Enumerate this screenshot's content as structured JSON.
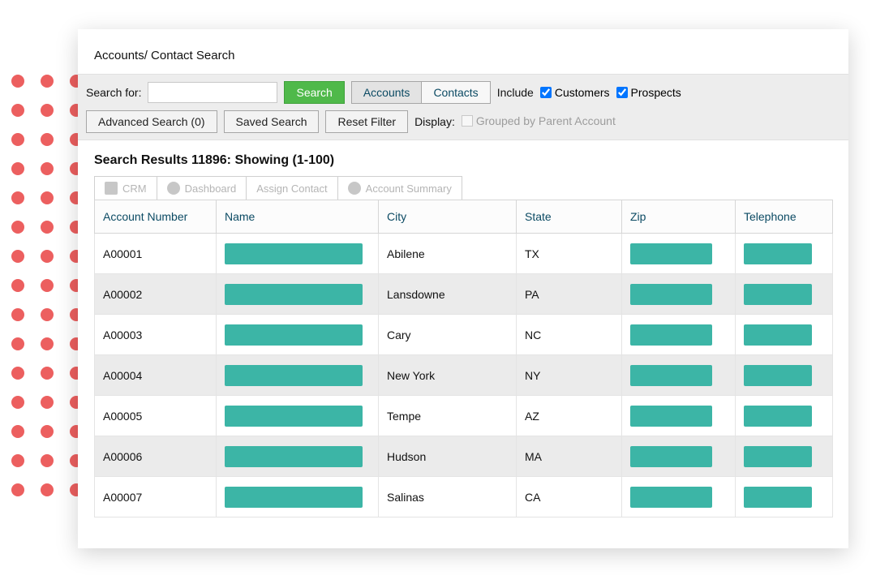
{
  "title": "Accounts/ Contact Search",
  "searchbar": {
    "searchfor_label": "Search for:",
    "search_input_value": "",
    "search_button": "Search",
    "segment_accounts": "Accounts",
    "segment_contacts": "Contacts",
    "include_label": "Include",
    "customers_label": "Customers",
    "customers_checked": true,
    "prospects_label": "Prospects",
    "prospects_checked": true,
    "advanced_search": "Advanced Search (0)",
    "saved_search": "Saved Search",
    "reset_filter": "Reset Filter",
    "display_label": "Display:",
    "grouped_label": "Grouped by Parent Account"
  },
  "results_heading": "Search Results 11896: Showing (1-100)",
  "toolbar": {
    "crm": "CRM",
    "dashboard": "Dashboard",
    "assign_contact": "Assign Contact",
    "account_summary": "Account Summary"
  },
  "columns": {
    "account_number": "Account Number",
    "name": "Name",
    "city": "City",
    "state": "State",
    "zip": "Zip",
    "telephone": "Telephone"
  },
  "rows": [
    {
      "account": "A00001",
      "city": "Abilene",
      "state": "TX"
    },
    {
      "account": "A00002",
      "city": "Lansdowne",
      "state": "PA"
    },
    {
      "account": "A00003",
      "city": "Cary",
      "state": "NC"
    },
    {
      "account": "A00004",
      "city": "New York",
      "state": "NY"
    },
    {
      "account": "A00005",
      "city": "Tempe",
      "state": "AZ"
    },
    {
      "account": "A00006",
      "city": "Hudson",
      "state": "MA"
    },
    {
      "account": "A00007",
      "city": "Salinas",
      "state": "CA"
    }
  ]
}
